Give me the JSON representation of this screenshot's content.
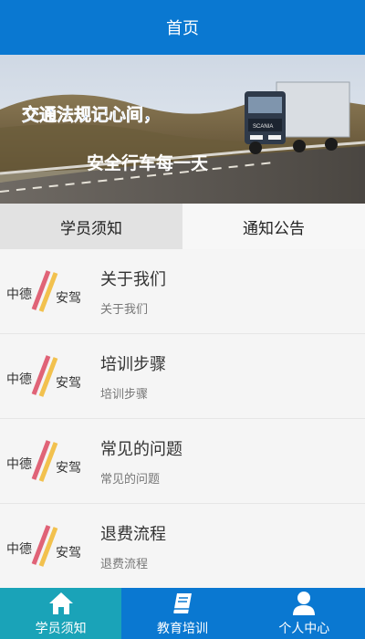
{
  "header": {
    "title": "首页"
  },
  "banner": {
    "line1": "交通法规记心间，",
    "line2": "安全行车每一天",
    "truck_text": "SCANIA"
  },
  "tabs": [
    {
      "label": "学员须知",
      "active": true
    },
    {
      "label": "通知公告",
      "active": false
    }
  ],
  "list": {
    "logo_text_left": "中德",
    "logo_text_right": "安驾",
    "items": [
      {
        "title": "关于我们",
        "subtitle": "关于我们"
      },
      {
        "title": "培训步骤",
        "subtitle": "培训步骤"
      },
      {
        "title": "常见的问题",
        "subtitle": "常见的问题"
      },
      {
        "title": "退费流程",
        "subtitle": "退费流程"
      }
    ]
  },
  "bottom_nav": [
    {
      "label": "学员须知",
      "icon": "home-icon",
      "active": true
    },
    {
      "label": "教育培训",
      "icon": "book-icon",
      "active": false
    },
    {
      "label": "个人中心",
      "icon": "user-icon",
      "active": false
    }
  ],
  "colors": {
    "primary": "#0a78d1",
    "active_nav": "#1aa3b8"
  }
}
